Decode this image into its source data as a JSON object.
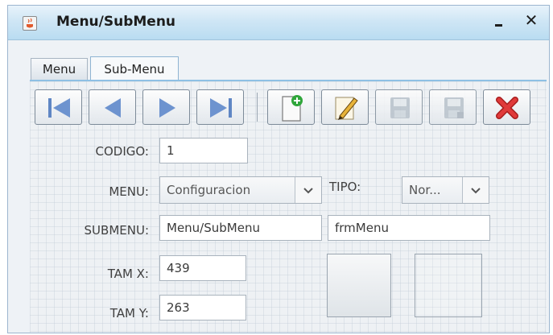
{
  "window": {
    "title": "Menu/SubMenu",
    "app_icon": "java-cup-icon",
    "minimize_icon": "minimize-icon",
    "close_icon": "close-icon",
    "close_glyph": "✕"
  },
  "tabs": [
    {
      "label": "Menu",
      "selected": false
    },
    {
      "label": "Sub-Menu",
      "selected": true
    }
  ],
  "toolbar": {
    "buttons": [
      {
        "name": "first-record-button",
        "icon": "skip-first-icon",
        "enabled": true
      },
      {
        "name": "previous-record-button",
        "icon": "previous-icon",
        "enabled": true
      },
      {
        "name": "next-record-button",
        "icon": "next-icon",
        "enabled": true
      },
      {
        "name": "last-record-button",
        "icon": "skip-last-icon",
        "enabled": true
      },
      {
        "name": "new-record-button",
        "icon": "new-document-icon",
        "enabled": true
      },
      {
        "name": "edit-record-button",
        "icon": "pencil-edit-icon",
        "enabled": true
      },
      {
        "name": "save-button",
        "icon": "floppy-disk-icon",
        "enabled": false
      },
      {
        "name": "save-as-button",
        "icon": "floppy-disk-icon",
        "enabled": false
      },
      {
        "name": "delete-button",
        "icon": "red-x-icon",
        "enabled": true
      }
    ]
  },
  "form": {
    "codigo_label": "CODIGO:",
    "codigo_value": "1",
    "menu_label": "MENU:",
    "menu_value": "Configuracion",
    "tipo_label": "TIPO:",
    "tipo_value": "Nor...",
    "submenu_label": "SUBMENU:",
    "submenu_value": "Menu/SubMenu",
    "form_name_value": "frmMenu",
    "tamx_label": "TAM X:",
    "tamx_value": "439",
    "tamy_label": "TAM Y:",
    "tamy_value": "263"
  },
  "colors": {
    "titlebar": "#cfe6f5",
    "tab_border_active": "#8ec0e4",
    "delete_red": "#d42b2b",
    "new_green": "#2fa63a",
    "nav_blue": "#5f86c4"
  }
}
